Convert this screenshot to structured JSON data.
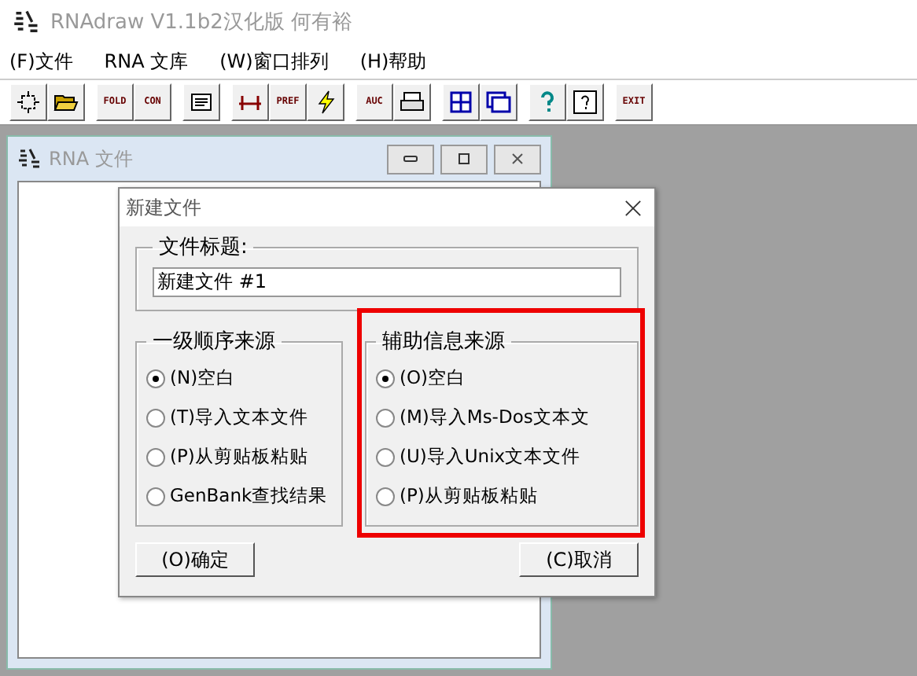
{
  "window": {
    "title": "RNAdraw V1.1b2汉化版 何有裕"
  },
  "menu": [
    {
      "label": "(F)文件"
    },
    {
      "label": "RNA 文库"
    },
    {
      "label": "(W)窗口排列"
    },
    {
      "label": "(H)帮助"
    }
  ],
  "toolbar": [
    [
      {
        "kind": "select"
      },
      {
        "kind": "open"
      }
    ],
    [
      {
        "kind": "text",
        "label": "FOLD"
      },
      {
        "kind": "text",
        "label": "CON"
      }
    ],
    [
      {
        "kind": "doc"
      }
    ],
    [
      {
        "kind": "bracket"
      },
      {
        "kind": "text",
        "label": "PREF"
      },
      {
        "kind": "bolt"
      }
    ],
    [
      {
        "kind": "text",
        "label": "AUC"
      },
      {
        "kind": "print"
      }
    ],
    [
      {
        "kind": "tile"
      },
      {
        "kind": "cascade"
      }
    ],
    [
      {
        "kind": "help"
      },
      {
        "kind": "helpbox"
      }
    ],
    [
      {
        "kind": "text",
        "label": "EXIT"
      }
    ]
  ],
  "child_window": {
    "title": "RNA 文件"
  },
  "dialog": {
    "title": "新建文件",
    "file_title": {
      "label": "文件标题:",
      "value": "新建文件 #1"
    },
    "groups": [
      {
        "label": "一级顺序来源",
        "options": [
          {
            "label": "(N)空白",
            "selected": true
          },
          {
            "label": "(T)导入文本文件",
            "selected": false
          },
          {
            "label": "(P)从剪贴板粘贴",
            "selected": false
          },
          {
            "label": "GenBank查找结果",
            "selected": false
          }
        ]
      },
      {
        "label": "辅助信息来源",
        "options": [
          {
            "label": "(O)空白",
            "selected": true
          },
          {
            "label": "(M)导入Ms-Dos文本文",
            "selected": false
          },
          {
            "label": "(U)导入Unix文本文件",
            "selected": false
          },
          {
            "label": "(P)从剪贴板粘贴",
            "selected": false
          }
        ]
      }
    ],
    "buttons": [
      {
        "label": "(O)确定"
      },
      {
        "label": "(C)取消"
      }
    ]
  }
}
